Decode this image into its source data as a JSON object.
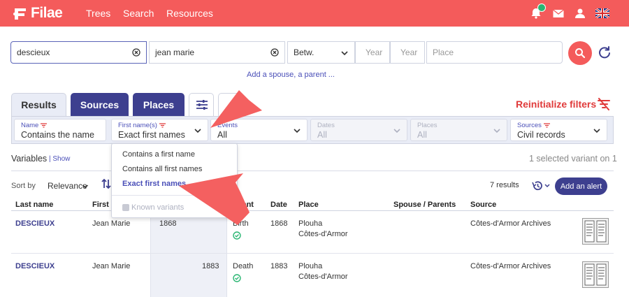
{
  "brand": {
    "name": "Filae",
    "accent": "#f45b5b",
    "primary": "#3d3f8f"
  },
  "nav": {
    "items": [
      "Trees",
      "Search",
      "Resources"
    ]
  },
  "nav_icons": [
    "bell-icon",
    "mail-icon",
    "user-icon",
    "uk-flag-icon"
  ],
  "search": {
    "last_name": "descieux",
    "first_name": "jean marie",
    "date_mode": "Betw.",
    "year_from_placeholder": "Year",
    "year_to_placeholder": "Year",
    "place_placeholder": "Place",
    "add_spouse": "Add a spouse, a parent ..."
  },
  "tabs": {
    "results": "Results",
    "sources": "Sources",
    "places": "Places"
  },
  "reinit": "Reinitialize filters",
  "filters": {
    "name": {
      "label": "Name",
      "value": "Contains the name"
    },
    "first_names": {
      "label": "First name(s)",
      "value": "Exact first names"
    },
    "events": {
      "label": "Events",
      "value": "All"
    },
    "dates": {
      "label": "Dates",
      "value": "All"
    },
    "places": {
      "label": "Places",
      "value": "All"
    },
    "sources": {
      "label": "Sources",
      "value": "Civil records"
    }
  },
  "variables": {
    "label": "Variables",
    "show": "Show",
    "variant_info": "1 selected variant on 1"
  },
  "sort": {
    "label": "Sort by",
    "value": "Relevance"
  },
  "results_count": "7 results",
  "alert_button": "Add an alert",
  "dropdown": {
    "options": [
      "Contains a first name",
      "Contains all first names",
      "Exact first names"
    ],
    "selected": "Exact first names",
    "known_variants": "Known variants"
  },
  "table": {
    "headers": {
      "last_name": "Last name",
      "first_name": "First n",
      "event": "Event",
      "date": "Date",
      "place": "Place",
      "spouse": "Spouse / Parents",
      "source": "Source"
    },
    "rows": [
      {
        "last_name": "DESCIEUX",
        "first_name": "Jean Marie",
        "year": "1868",
        "event": "Birth",
        "date": "1868",
        "place1": "Plouha",
        "place2": "Côtes-d'Armor",
        "source": "Côtes-d'Armor Archives"
      },
      {
        "last_name": "DESCIEUX",
        "first_name": "Jean Marie",
        "year": "1883",
        "event": "Death",
        "date": "1883",
        "place1": "Plouha",
        "place2": "Côtes-d'Armor",
        "source": "Côtes-d'Armor Archives"
      }
    ]
  }
}
